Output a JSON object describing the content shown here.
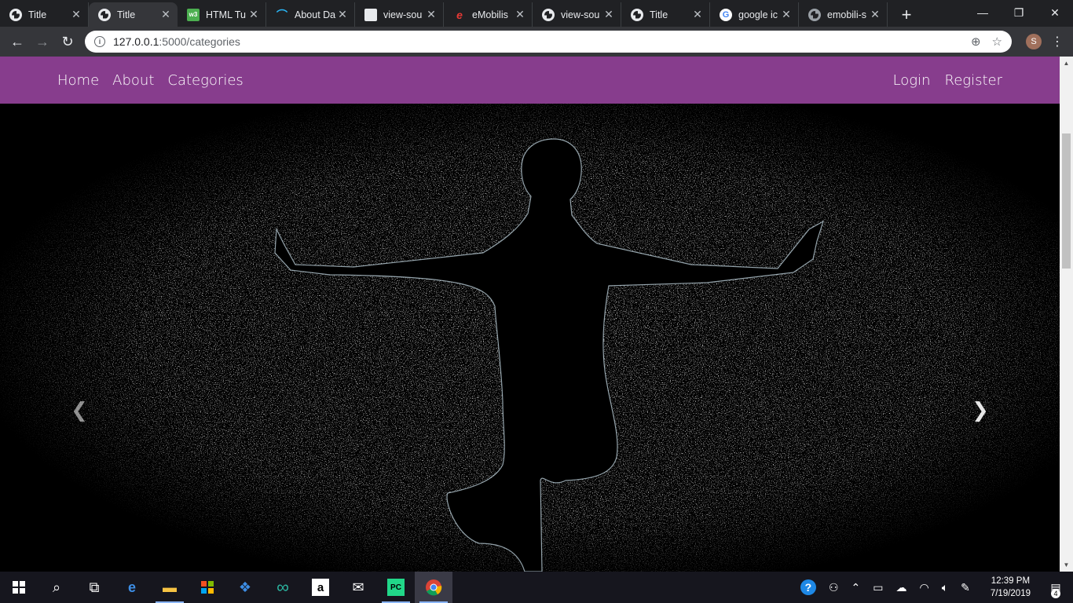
{
  "browser": {
    "tabs": [
      {
        "title": "Title",
        "icon": "globe-icon",
        "active": false
      },
      {
        "title": "Title",
        "icon": "globe-icon",
        "active": true
      },
      {
        "title": "HTML Tu",
        "icon": "w3schools-icon",
        "active": false
      },
      {
        "title": "About Da",
        "icon": "wave-icon",
        "active": false
      },
      {
        "title": "view-sou",
        "icon": "page-icon",
        "active": false
      },
      {
        "title": "eMobilis",
        "icon": "e-logo-icon",
        "active": false
      },
      {
        "title": "view-sou",
        "icon": "globe-icon",
        "active": false
      },
      {
        "title": "Title",
        "icon": "globe-icon",
        "active": false
      },
      {
        "title": "google ic",
        "icon": "google-icon",
        "active": false
      },
      {
        "title": "emobili-s",
        "icon": "globe-icon",
        "active": false
      }
    ],
    "url_host": "127.0.0.1",
    "url_path": ":5000/categories",
    "profile_initial": "S"
  },
  "site": {
    "nav_left": [
      "Home",
      "About",
      "Categories"
    ],
    "nav_right": [
      "Login",
      "Register"
    ],
    "nav_color": "#873d8d"
  },
  "carousel": {
    "prev_icon": "chevron-left-icon",
    "next_icon": "chevron-right-icon"
  },
  "taskbar": {
    "time": "12:39 PM",
    "date": "7/19/2019",
    "notifications": "4"
  }
}
